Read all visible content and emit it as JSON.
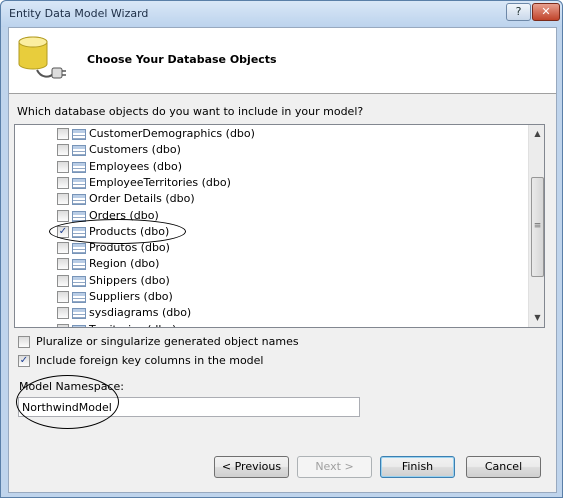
{
  "window": {
    "title": "Entity Data Model Wizard",
    "help_label": "?",
    "close_label": "✕"
  },
  "header": {
    "title": "Choose Your Database Objects",
    "icon": "database-plug-icon"
  },
  "prompt": "Which database objects do you want to include in your model?",
  "objects": [
    {
      "label": "CustomerDemographics (dbo)",
      "checked": false
    },
    {
      "label": "Customers (dbo)",
      "checked": false
    },
    {
      "label": "Employees (dbo)",
      "checked": false
    },
    {
      "label": "EmployeeTerritories (dbo)",
      "checked": false
    },
    {
      "label": "Order Details (dbo)",
      "checked": false
    },
    {
      "label": "Orders (dbo)",
      "checked": false
    },
    {
      "label": "Products (dbo)",
      "checked": true
    },
    {
      "label": "Produtos (dbo)",
      "checked": false
    },
    {
      "label": "Region (dbo)",
      "checked": false
    },
    {
      "label": "Shippers (dbo)",
      "checked": false
    },
    {
      "label": "Suppliers (dbo)",
      "checked": false
    },
    {
      "label": "sysdiagrams (dbo)",
      "checked": false
    },
    {
      "label": "Territories (dbo)",
      "checked": false
    }
  ],
  "options": {
    "pluralize": {
      "label": "Pluralize or singularize generated object names",
      "checked": false
    },
    "foreign_keys": {
      "label": "Include foreign key columns in the model",
      "checked": true
    }
  },
  "namespace": {
    "label": "Model Namespace:",
    "value": "NorthwindModel"
  },
  "buttons": {
    "previous": "< Previous",
    "next": "Next >",
    "finish": "Finish",
    "cancel": "Cancel"
  },
  "scrollbar": {
    "up_arrow": "▲",
    "down_arrow": "▼",
    "grip": "≡"
  }
}
